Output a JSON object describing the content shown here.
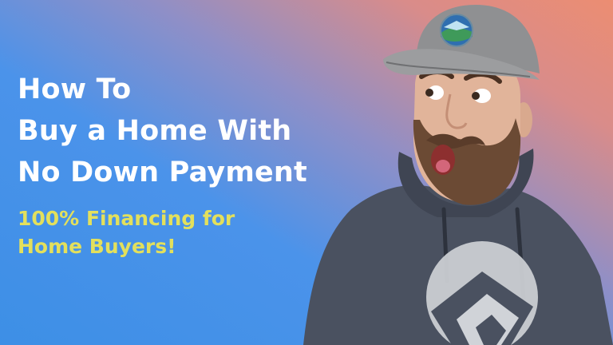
{
  "headline": {
    "line1": "How To",
    "line2": "Buy a Home With",
    "line3": "No Down Payment"
  },
  "subheadline": {
    "line1": "100% Financing for",
    "line2": "Home Buyers!"
  },
  "colors": {
    "headline": "#ffffff",
    "subheadline": "#e3e05c",
    "gradient_left": "#3d8fe6",
    "gradient_right": "#ec8d72",
    "hoodie": "#4a5160",
    "cap": "#8f9092"
  }
}
